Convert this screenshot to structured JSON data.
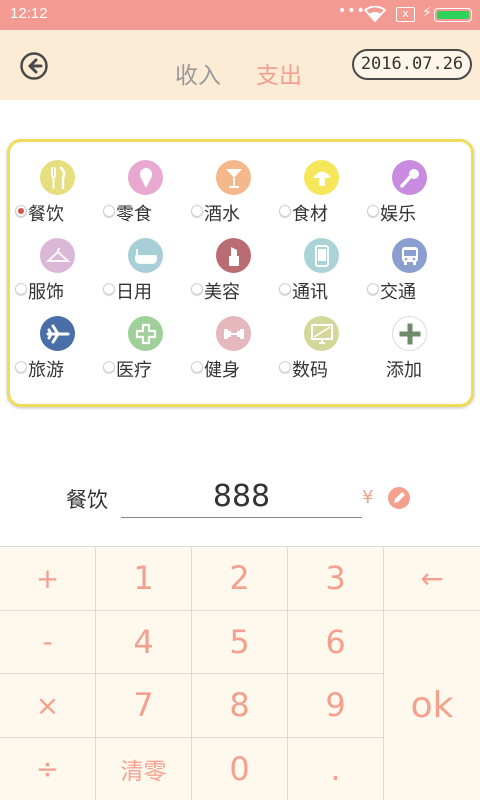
{
  "status_bar": {
    "time": "12:12",
    "dots": "•••",
    "sim_icon_label": "x",
    "colors": {
      "background": "#f39b92",
      "battery": "#2ed15a"
    }
  },
  "header": {
    "tabs": [
      {
        "label": "收入",
        "active": false
      },
      {
        "label": "支出",
        "active": true
      }
    ],
    "date": "2016.07.26",
    "colors": {
      "active_tab": "#f4a08f",
      "inactive_tab": "#9a9a9a",
      "background": "#fcecd6"
    }
  },
  "categories": [
    {
      "label": "餐饮",
      "icon": "fork-knife-icon",
      "color": "#e6df7f",
      "selected": true
    },
    {
      "label": "零食",
      "icon": "ice-cream-icon",
      "color": "#e8a8cf",
      "selected": false
    },
    {
      "label": "酒水",
      "icon": "cocktail-icon",
      "color": "#f4b88a",
      "selected": false
    },
    {
      "label": "食材",
      "icon": "mushroom-icon",
      "color": "#f5e65a",
      "selected": false
    },
    {
      "label": "娱乐",
      "icon": "microphone-icon",
      "color": "#c88be0",
      "selected": false
    },
    {
      "label": "服饰",
      "icon": "hanger-icon",
      "color": "#dbb8d8",
      "selected": false
    },
    {
      "label": "日用",
      "icon": "bathtub-icon",
      "color": "#a8cfd8",
      "selected": false
    },
    {
      "label": "美容",
      "icon": "lipstick-icon",
      "color": "#b96d72",
      "selected": false
    },
    {
      "label": "通讯",
      "icon": "phone-icon",
      "color": "#a9d3d4",
      "selected": false
    },
    {
      "label": "交通",
      "icon": "bus-icon",
      "color": "#8a9fd0",
      "selected": false
    },
    {
      "label": "旅游",
      "icon": "airplane-icon",
      "color": "#4a6fa8",
      "selected": false
    },
    {
      "label": "医疗",
      "icon": "medical-cross-icon",
      "color": "#9fd09a",
      "selected": false
    },
    {
      "label": "健身",
      "icon": "dumbbell-icon",
      "color": "#e4b8bc",
      "selected": false
    },
    {
      "label": "数码",
      "icon": "monitor-icon",
      "color": "#d4d79a",
      "selected": false
    },
    {
      "label": "添加",
      "icon": "plus-icon",
      "color": "#ffffff",
      "add": true
    }
  ],
  "amount": {
    "category_label": "餐饮",
    "value": "888",
    "currency": "¥"
  },
  "keypad": {
    "keys": [
      {
        "label": "+",
        "kind": "op"
      },
      {
        "label": "1",
        "kind": "num"
      },
      {
        "label": "2",
        "kind": "num"
      },
      {
        "label": "3",
        "kind": "num"
      },
      {
        "label": "←",
        "kind": "op"
      },
      {
        "label": "-",
        "kind": "op"
      },
      {
        "label": "4",
        "kind": "num"
      },
      {
        "label": "5",
        "kind": "num"
      },
      {
        "label": "6",
        "kind": "num"
      },
      {
        "label": "×",
        "kind": "op"
      },
      {
        "label": "7",
        "kind": "num"
      },
      {
        "label": "8",
        "kind": "num"
      },
      {
        "label": "9",
        "kind": "num"
      },
      {
        "label": "ok",
        "kind": "ok"
      },
      {
        "label": "÷",
        "kind": "op"
      },
      {
        "label": "清零",
        "kind": "clear"
      },
      {
        "label": "0",
        "kind": "num"
      },
      {
        "label": ".",
        "kind": "num"
      }
    ],
    "colors": {
      "text": "#f4a08f",
      "background": "#fff8ec"
    }
  }
}
